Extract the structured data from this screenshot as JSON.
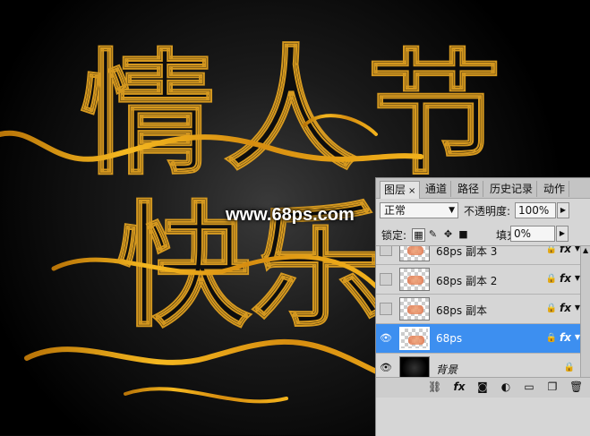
{
  "canvas": {
    "heading_chars": [
      "情",
      "人",
      "节",
      "快",
      "乐"
    ],
    "watermark": "www.68ps.com"
  },
  "panel": {
    "tabs": [
      {
        "label": "图层",
        "close": "×"
      },
      {
        "label": "通道"
      },
      {
        "label": "路径"
      },
      {
        "label": "历史记录"
      },
      {
        "label": "动作"
      }
    ],
    "blend_mode": "正常",
    "opacity_label": "不透明度:",
    "opacity_value": "100%",
    "lock_label": "锁定:",
    "fill_label": "填充:",
    "fill_value": "0%",
    "layers": [
      {
        "name": "68ps  副本 3",
        "visible": false,
        "fx": "fx"
      },
      {
        "name": "68ps  副本 2",
        "visible": false,
        "fx": "fx"
      },
      {
        "name": "68ps  副本",
        "visible": false,
        "fx": "fx"
      },
      {
        "name": "68ps",
        "visible": true,
        "fx": "fx",
        "selected": true
      },
      {
        "name": "背景",
        "visible": true,
        "background": true
      }
    ],
    "bottom_icons": [
      "link-icon",
      "fx-icon",
      "mask-icon",
      "adjustment-icon",
      "folder-icon",
      "new-layer-icon",
      "trash-icon"
    ],
    "bottom_fx": "fx"
  },
  "colors": {
    "accent": "#e8a317",
    "selected": "#3d8ff0",
    "panel": "#d6d6d6"
  }
}
